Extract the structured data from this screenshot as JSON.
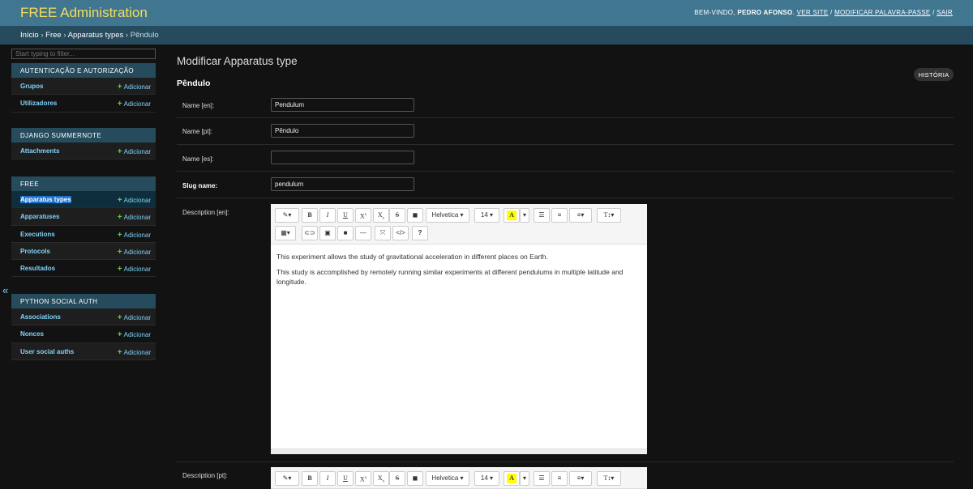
{
  "header": {
    "branding": "FREE Administration",
    "welcome": "BEM-VINDO,",
    "user": "PEDRO AFONSO",
    "view_site": "VER SITE",
    "change_password": "MODIFICAR PALAVRA-PASSE",
    "logout": "SAIR"
  },
  "breadcrumbs": {
    "home": "Início",
    "app": "Free",
    "model": "Apparatus types",
    "current": "Pêndulo"
  },
  "sidebar": {
    "filter_placeholder": "Start typing to filter...",
    "add_label": "Adicionar",
    "modules": [
      {
        "caption": "AUTENTICAÇÃO E AUTORIZAÇÃO",
        "items": [
          "Grupos",
          "Utilizadores"
        ]
      },
      {
        "caption": "DJANGO SUMMERNOTE",
        "items": [
          "Attachments"
        ]
      },
      {
        "caption": "FREE",
        "items": [
          "Apparatus types",
          "Apparatuses",
          "Executions",
          "Protocols",
          "Resultados"
        ]
      },
      {
        "caption": "PYTHON SOCIAL AUTH",
        "items": [
          "Associations",
          "Nonces",
          "User social auths"
        ]
      }
    ],
    "collapse_icon": "«"
  },
  "main": {
    "title": "Modificar Apparatus type",
    "object_name": "Pêndulo",
    "history_button": "HISTÓRIA",
    "fields": {
      "name_en": {
        "label": "Name [en]:",
        "value": "Pendulum"
      },
      "name_pt": {
        "label": "Name [pt]:",
        "value": "Pêndulo"
      },
      "name_es": {
        "label": "Name [es]:",
        "value": ""
      },
      "slug": {
        "label": "Slug name:",
        "value": "pendulum"
      },
      "description_en": {
        "label": "Description [en]:"
      },
      "description_pt": {
        "label": "Description [pt]:"
      }
    },
    "editor": {
      "font_name": "Helvetica",
      "font_size": "14",
      "paragraphs_en": [
        "This experiment allows the study of gravitational acceleration in different places on Earth.",
        "This study is accomplished  by remotely running similar experiments at different pendulums in multiple latitude and longitude."
      ]
    }
  },
  "colors": {
    "header_bg": "#417690",
    "breadcrumb_bg": "#264b5d",
    "branding": "#f5dd5d",
    "link": "#81d4fa",
    "add_plus": "#5ec94a",
    "page_bg": "#121212"
  }
}
